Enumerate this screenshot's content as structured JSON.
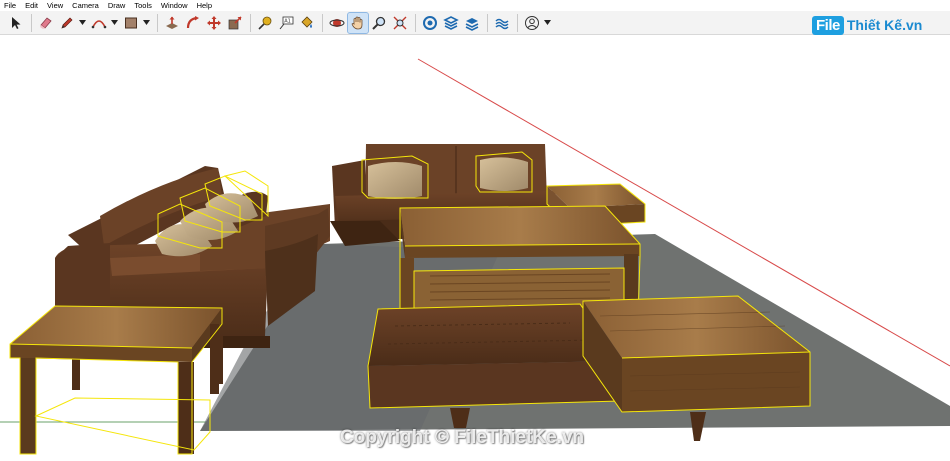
{
  "menu": [
    "File",
    "Edit",
    "View",
    "Camera",
    "Draw",
    "Tools",
    "Window",
    "Help"
  ],
  "toolbar": {
    "tools": [
      {
        "name": "select-tool",
        "icon": "arrow-cursor-icon"
      },
      {
        "name": "eraser-tool",
        "icon": "eraser-icon"
      },
      {
        "name": "line-tool",
        "icon": "pencil-icon",
        "dropdown": true
      },
      {
        "name": "arc-tool",
        "icon": "arc-icon",
        "dropdown": true
      },
      {
        "name": "shape-tool",
        "icon": "rectangle-icon",
        "dropdown": true
      },
      {
        "name": "push-pull-tool",
        "icon": "push-pull-icon"
      },
      {
        "name": "follow-me-tool",
        "icon": "follow-me-icon"
      },
      {
        "name": "move-tool",
        "icon": "move-icon"
      },
      {
        "name": "scale-tool",
        "icon": "scale-icon"
      },
      {
        "name": "tape-measure-tool",
        "icon": "tape-measure-icon"
      },
      {
        "name": "text-tool",
        "icon": "text-icon"
      },
      {
        "name": "paint-bucket-tool",
        "icon": "paint-bucket-icon"
      },
      {
        "name": "orbit-tool",
        "icon": "orbit-icon"
      },
      {
        "name": "pan-tool",
        "icon": "hand-icon",
        "active": true
      },
      {
        "name": "zoom-tool",
        "icon": "magnifier-icon"
      },
      {
        "name": "zoom-extents-tool",
        "icon": "zoom-extents-icon"
      },
      {
        "name": "warehouse-tool",
        "icon": "warehouse-icon"
      },
      {
        "name": "extension-tool",
        "icon": "extension-icon"
      },
      {
        "name": "layer-tool",
        "icon": "layers-icon"
      },
      {
        "name": "sandbox-tool",
        "icon": "sandbox-icon"
      },
      {
        "name": "account-button",
        "icon": "user-icon",
        "dropdown": true
      }
    ]
  },
  "logo": {
    "file": "File",
    "rest": "Thiết Kế.vn"
  },
  "watermark": "Copyright © FileThietKe.vn",
  "colors": {
    "wood_dark": "#5a3a1e",
    "wood_light": "#8b6234",
    "cushion": "#5e3a22",
    "rug": "#6f7270",
    "selection": "#f5e60a",
    "accent_blue": "#1e9fe0"
  }
}
